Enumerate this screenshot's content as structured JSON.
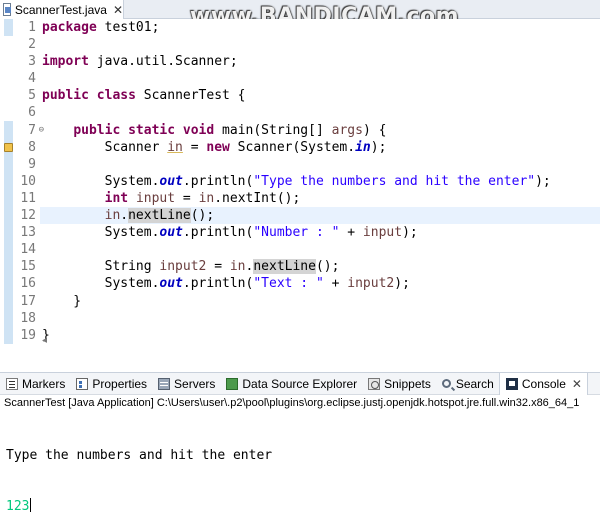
{
  "editor": {
    "tab_title": "ScannerTest.java",
    "tab_close": "✕",
    "line_numbers": [
      "1",
      "2",
      "3",
      "4",
      "5",
      "6",
      "7",
      "8",
      "9",
      "10",
      "11",
      "12",
      "13",
      "14",
      "15",
      "16",
      "17",
      "18",
      "19"
    ]
  },
  "watermark": "www.BANDICAM.com",
  "code": {
    "l1": [
      "package",
      " test01;"
    ],
    "l3": [
      "import",
      " java.util.Scanner;"
    ],
    "l5": [
      "public",
      " ",
      "class",
      " ScannerTest {"
    ],
    "l7": [
      "    ",
      "public",
      " ",
      "static",
      " ",
      "void",
      " main(String[] ",
      "args",
      ") {"
    ],
    "l8": [
      "        Scanner ",
      "in",
      " = ",
      "new",
      " Scanner(System.",
      "in",
      ");"
    ],
    "l10": [
      "        System.",
      "out",
      ".println(",
      "\"Type the numbers and hit the enter\"",
      ");"
    ],
    "l11": [
      "        ",
      "int",
      " ",
      "input",
      " = ",
      "in",
      ".nextInt();"
    ],
    "l12": [
      "        ",
      "in",
      ".",
      "nextLine",
      "();"
    ],
    "l13": [
      "        System.",
      "out",
      ".println(",
      "\"Number : \"",
      " + ",
      "input",
      ");"
    ],
    "l15": [
      "        String ",
      "input2",
      " = ",
      "in",
      ".",
      "nextLine",
      "();"
    ],
    "l16": [
      "        System.",
      "out",
      ".println(",
      "\"Text : \"",
      " + ",
      "input2",
      ");"
    ],
    "l17": [
      "    }"
    ],
    "l19": [
      "}"
    ]
  },
  "panel": {
    "tabs": [
      {
        "label": "Markers"
      },
      {
        "label": "Properties"
      },
      {
        "label": "Servers"
      },
      {
        "label": "Data Source Explorer"
      },
      {
        "label": "Snippets"
      },
      {
        "label": "Search"
      },
      {
        "label": "Console"
      }
    ],
    "tab_close": "✕",
    "console_header": "ScannerTest [Java Application] C:\\Users\\user\\.p2\\pool\\plugins\\org.eclipse.justj.openjdk.hotspot.jre.full.win32.x86_64_1",
    "console_output": "Type the numbers and hit the enter",
    "console_input": "123"
  },
  "colors": {
    "keyword": "#7f0055",
    "string": "#2a00ff",
    "field": "#0000c0",
    "console_input": "#00c87d",
    "current_line": "#e8f2fe"
  }
}
